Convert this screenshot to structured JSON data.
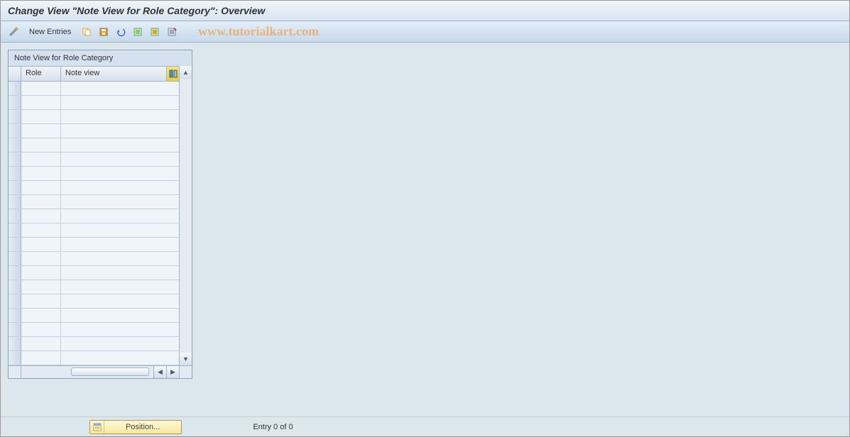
{
  "header": {
    "title": "Change View \"Note View for Role Category\": Overview"
  },
  "toolbar": {
    "new_entries_label": "New Entries",
    "watermark": "www.tutorialkart.com"
  },
  "table": {
    "panel_title": "Note View for Role Category",
    "columns": {
      "role": "Role",
      "note_view": "Note view"
    },
    "row_count": 20
  },
  "footer": {
    "position_label": "Position...",
    "entry_text": "Entry 0 of 0"
  }
}
